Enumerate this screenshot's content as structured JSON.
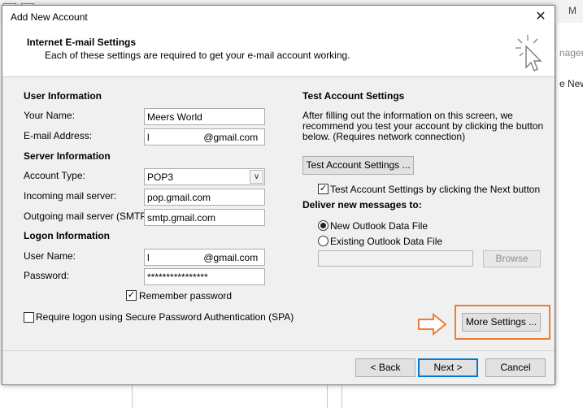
{
  "background": {
    "window_title": "M",
    "right_text_1": "nager",
    "right_text_2": "e New"
  },
  "dialog": {
    "title": "Add New Account",
    "header": {
      "title": "Internet E-mail Settings",
      "subtitle": "Each of these settings are required to get your e-mail account working."
    },
    "user_info": {
      "heading": "User Information",
      "your_name_label": "Your Name:",
      "your_name_value": "Meers World",
      "email_label": "E-mail Address:",
      "email_value": "l                    @gmail.com"
    },
    "server_info": {
      "heading": "Server Information",
      "account_type_label": "Account Type:",
      "account_type_value": "POP3",
      "incoming_label": "Incoming mail server:",
      "incoming_value": "pop.gmail.com",
      "outgoing_label": "Outgoing mail server (SMTP):",
      "outgoing_value": "smtp.gmail.com"
    },
    "logon_info": {
      "heading": "Logon Information",
      "username_label": "User Name:",
      "username_value": "l                    @gmail.com",
      "password_label": "Password:",
      "password_value": "****************",
      "remember_label": "Remember password",
      "spa_label": "Require logon using Secure Password Authentication (SPA)"
    },
    "test_settings": {
      "heading": "Test Account Settings",
      "description_1": "After filling out the information on this screen, we",
      "description_2": "recommend you test your account by clicking the button",
      "description_3": "below. (Requires network connection)",
      "test_button": "Test Account Settings ...",
      "test_checkbox_label": "Test Account Settings by clicking the Next button"
    },
    "deliver": {
      "heading": "Deliver new messages to:",
      "option_new": "New Outlook Data File",
      "option_existing": "Existing Outlook Data File",
      "browse_button": "Browse"
    },
    "more_settings_button": "More Settings ...",
    "footer": {
      "back_button": "< Back",
      "next_button": "Next >",
      "cancel_button": "Cancel"
    }
  },
  "colors": {
    "highlight": "#ed7d31",
    "focus_border": "#0078d7"
  }
}
